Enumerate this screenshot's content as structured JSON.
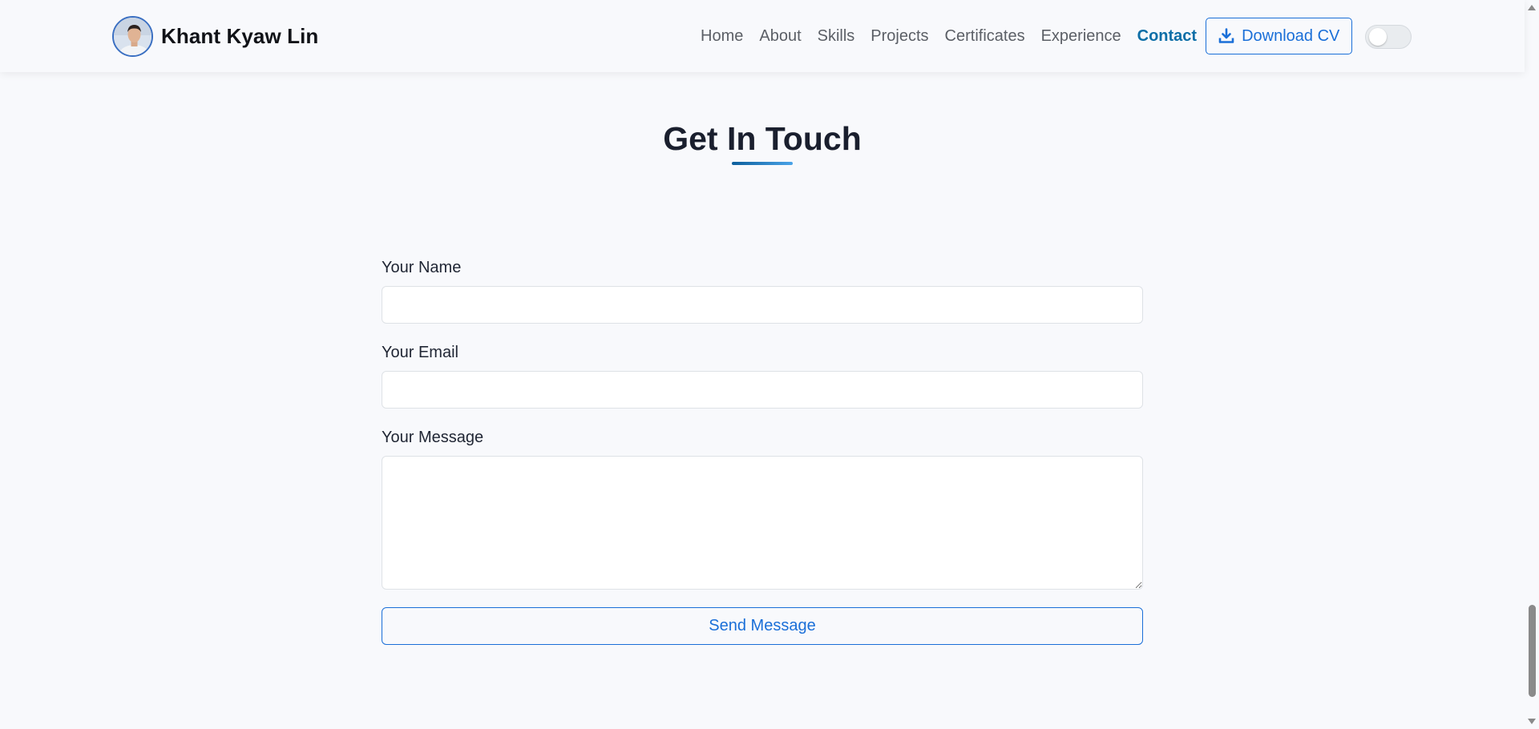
{
  "header": {
    "brand_name": "Khant Kyaw Lin",
    "nav": [
      {
        "label": "Home",
        "active": false
      },
      {
        "label": "About",
        "active": false
      },
      {
        "label": "Skills",
        "active": false
      },
      {
        "label": "Projects",
        "active": false
      },
      {
        "label": "Certificates",
        "active": false
      },
      {
        "label": "Experience",
        "active": false
      },
      {
        "label": "Contact",
        "active": true
      }
    ],
    "download_cv_label": "Download CV",
    "theme_toggle_on": false
  },
  "contact": {
    "title": "Get In Touch",
    "name_label": "Your Name",
    "name_value": "",
    "email_label": "Your Email",
    "email_value": "",
    "message_label": "Your Message",
    "message_value": "",
    "send_label": "Send Message"
  },
  "colors": {
    "accent": "#1a6fd8",
    "active_nav": "#0d6ea7",
    "background": "#f8f9fc"
  }
}
